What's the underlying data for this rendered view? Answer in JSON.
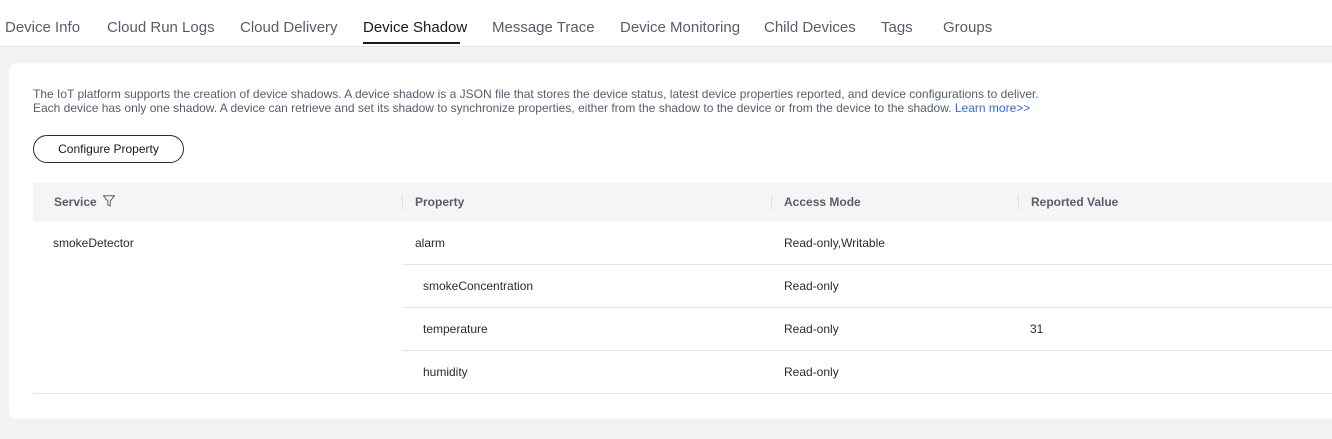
{
  "tabs": [
    {
      "label": "Device Info"
    },
    {
      "label": "Cloud Run Logs"
    },
    {
      "label": "Cloud Delivery"
    },
    {
      "label": "Device Shadow"
    },
    {
      "label": "Message Trace"
    },
    {
      "label": "Device Monitoring"
    },
    {
      "label": "Child Devices"
    },
    {
      "label": "Tags"
    },
    {
      "label": "Groups"
    }
  ],
  "active_tab": "Device Shadow",
  "description": {
    "line1": "The IoT platform supports the creation of device shadows. A device shadow is a JSON file that stores the device status, latest device properties reported, and device configurations to deliver.",
    "line2": "Each device has only one shadow. A device can retrieve and set its shadow to synchronize properties, either from the shadow to the device or from the device to the shadow.",
    "learn_more": "Learn more>>"
  },
  "configure_button": "Configure Property",
  "table": {
    "headers": {
      "service": "Service",
      "property": "Property",
      "access_mode": "Access Mode",
      "reported_value": "Reported Value"
    },
    "service": "smokeDetector",
    "rows": [
      {
        "property": "alarm",
        "access_mode": "Read-only,Writable",
        "reported_value": ""
      },
      {
        "property": "smokeConcentration",
        "access_mode": "Read-only",
        "reported_value": ""
      },
      {
        "property": "temperature",
        "access_mode": "Read-only",
        "reported_value": "31"
      },
      {
        "property": "humidity",
        "access_mode": "Read-only",
        "reported_value": ""
      }
    ]
  },
  "icons": {
    "filter": "filter-icon"
  },
  "colors": {
    "link": "#2e6ae0",
    "active_tab_underline": "#191919"
  }
}
